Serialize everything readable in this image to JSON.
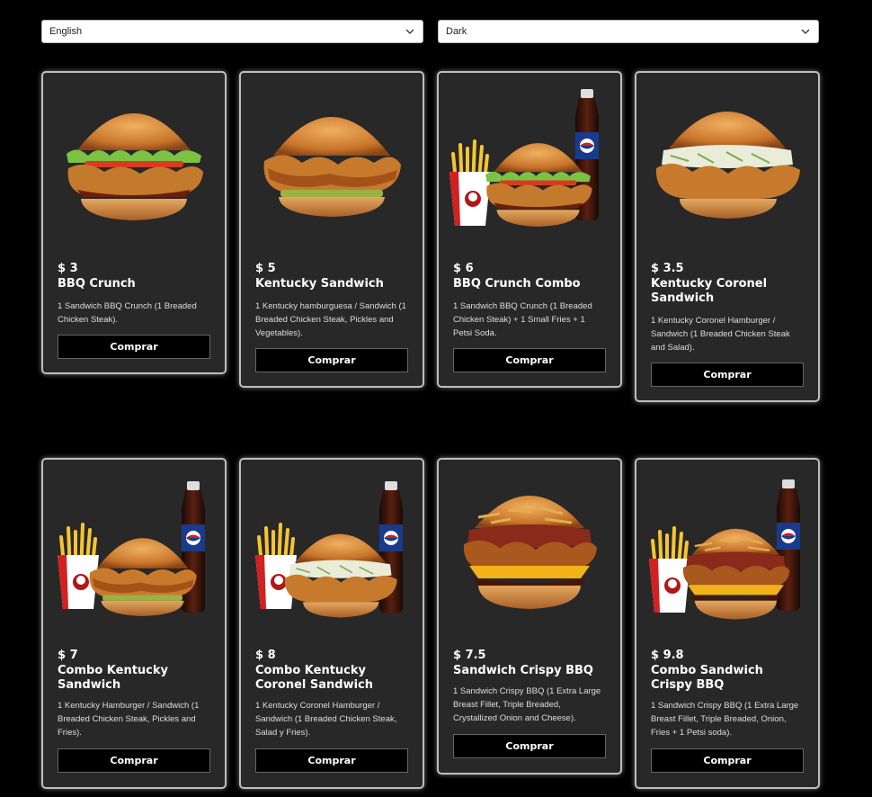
{
  "controls": {
    "language": "English",
    "theme": "Dark"
  },
  "buy_label": "Comprar",
  "products": [
    {
      "price": "$ 3",
      "name": "BBQ Crunch",
      "desc": "1 Sandwich BBQ Crunch (1 Breaded Chicken Steak).",
      "image": "bbq-crunch-burger-image"
    },
    {
      "price": "$ 5",
      "name": "Kentucky Sandwich",
      "desc": "1 Kentucky hamburguesa / Sandwich (1 Breaded Chicken Steak, Pickles and Vegetables).",
      "image": "kentucky-sandwich-image"
    },
    {
      "price": "$ 6",
      "name": "BBQ Crunch Combo",
      "desc": "1 Sandwich BBQ Crunch (1 Breaded Chicken Steak) + 1 Small Fries + 1 Petsi Soda.",
      "image": "bbq-crunch-combo-image"
    },
    {
      "price": "$ 3.5",
      "name": "Kentucky Coronel Sandwich",
      "desc": "1 Kentucky Coronel Hamburger / Sandwich (1 Breaded Chicken Steak and Salad).",
      "image": "kentucky-coronel-sandwich-image"
    },
    {
      "price": "$ 7",
      "name": "Combo Kentucky Sandwich",
      "desc": "1 Kentucky Hamburger / Sandwich (1 Breaded Chicken Steak, Pickles and Fries).",
      "image": "combo-kentucky-sandwich-image"
    },
    {
      "price": "$ 8",
      "name": "Combo Kentucky Coronel Sandwich",
      "desc": "1 Kentucky Coronel Hamburger / Sandwich (1 Breaded Chicken Steak, Salad y Fries).",
      "image": "combo-kentucky-coronel-image"
    },
    {
      "price": "$ 7.5",
      "name": "Sandwich Crispy BBQ",
      "desc": "1 Sandwich Crispy BBQ (1 Extra Large Breast Fillet, Triple Breaded, Crystallized Onion and Cheese).",
      "image": "sandwich-crispy-bbq-image"
    },
    {
      "price": "$ 9.8",
      "name": "Combo Sandwich Crispy BBQ",
      "desc": "1 Sandwich Crispy BBQ (1 Extra Large Breast Fillet, Triple Breaded, Onion, Fries + 1 Petsi soda).",
      "image": "combo-sandwich-crispy-bbq-image"
    }
  ]
}
